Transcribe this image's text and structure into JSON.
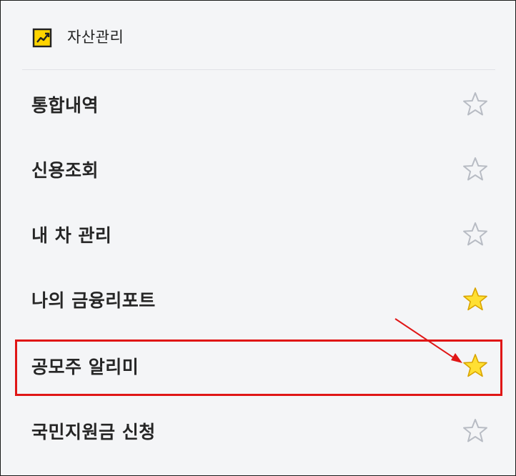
{
  "section": {
    "title": "자산관리",
    "icon": "chart-trend-icon"
  },
  "menu": {
    "items": [
      {
        "label": "통합내역",
        "favorite": false,
        "star_icon": "star-outline-icon"
      },
      {
        "label": "신용조회",
        "favorite": false,
        "star_icon": "star-outline-icon"
      },
      {
        "label": "내 차 관리",
        "favorite": false,
        "star_icon": "star-outline-icon"
      },
      {
        "label": "나의 금융리포트",
        "favorite": true,
        "star_icon": "star-filled-icon"
      },
      {
        "label": "공모주 알리미",
        "favorite": true,
        "star_icon": "star-filled-icon",
        "highlighted": true
      },
      {
        "label": "국민지원금 신청",
        "favorite": false,
        "star_icon": "star-outline-icon"
      }
    ]
  },
  "colors": {
    "background": "#f4f5f7",
    "star_filled": "#ffe033",
    "star_filled_stroke": "#d9a400",
    "star_outline": "#b8bcc4",
    "highlight": "#e01616",
    "icon_yellow": "#ffd400"
  }
}
